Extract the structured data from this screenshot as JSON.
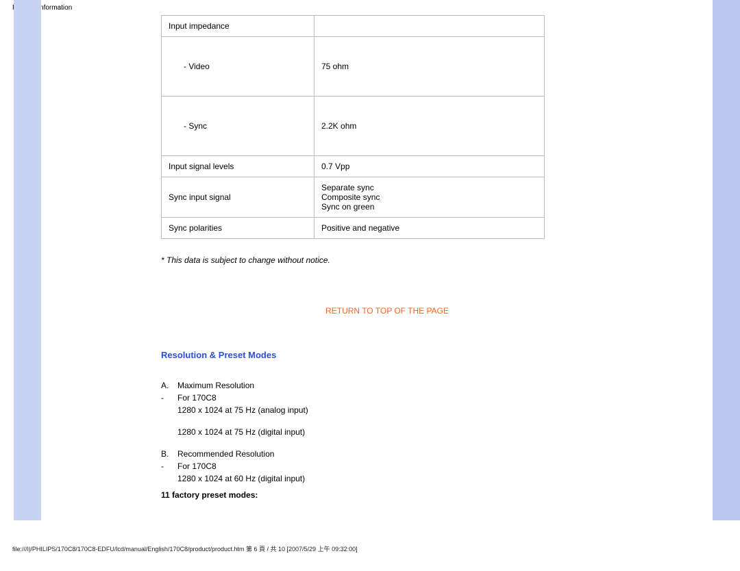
{
  "header": "Product Information",
  "spec_rows": [
    {
      "label": "Input impedance",
      "value": "",
      "indent": false,
      "tall": false
    },
    {
      "label": "- Video",
      "value": "75 ohm",
      "indent": true,
      "tall": true
    },
    {
      "label": "- Sync",
      "value": "2.2K ohm",
      "indent": true,
      "tall": true
    },
    {
      "label": "Input signal levels",
      "value": "0.7 Vpp",
      "indent": false,
      "tall": false
    },
    {
      "label": "Sync input signal",
      "value": "Separate sync\nComposite sync\nSync on green",
      "indent": false,
      "tall": false
    },
    {
      "label": "Sync polarities",
      "value": "Positive and negative",
      "indent": false,
      "tall": false
    }
  ],
  "note": "* This data is subject to change without notice.",
  "toplink": "RETURN TO TOP OF THE PAGE",
  "section_title": "Resolution & Preset Modes",
  "res": {
    "a_label": "A.",
    "a_text": "Maximum Resolution",
    "a_dash": "-",
    "a_for": "For 170C8",
    "a_line1": "1280 x 1024 at 75 Hz (analog input)",
    "a_line2": "1280 x 1024 at 75 Hz (digital input)",
    "b_label": "B.",
    "b_text": "Recommended Resolution",
    "b_dash": "-",
    "b_for": "For 170C8",
    "b_line1": "1280 x 1024 at 60 Hz (digital input)"
  },
  "preset_modes": "11 factory preset modes:",
  "footer": "file:///I|/PHILIPS/170C8/170C8-EDFU/lcd/manual/English/170C8/product/product.htm 第 6 頁 / 共 10 [2007/5/29 上午 09:32:00]"
}
